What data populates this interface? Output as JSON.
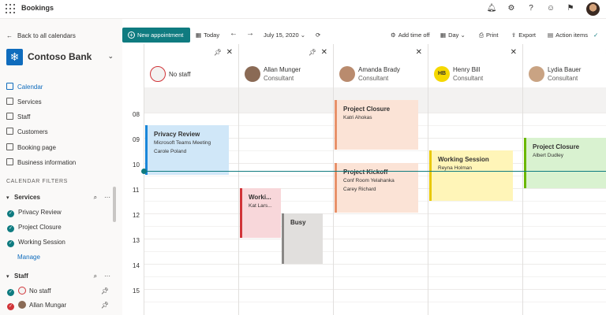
{
  "app": {
    "title": "Bookings"
  },
  "colors": {
    "accent": "#0f7b80",
    "brand": "#0f6cbd"
  },
  "sidebar": {
    "back_label": "Back to all calendars",
    "org_name": "Contoso Bank",
    "nav": [
      {
        "label": "Calendar",
        "icon": "calendar-icon",
        "active": true
      },
      {
        "label": "Services",
        "icon": "services-icon"
      },
      {
        "label": "Staff",
        "icon": "staff-icon"
      },
      {
        "label": "Customers",
        "icon": "customers-icon"
      },
      {
        "label": "Booking page",
        "icon": "booking-page-icon"
      },
      {
        "label": "Business information",
        "icon": "business-info-icon"
      }
    ],
    "filters_title": "CALENDAR FILTERS",
    "services_title": "Services",
    "services": [
      "Privacy Review",
      "Project Closure",
      "Working Session"
    ],
    "manage_label": "Manage",
    "staff_title": "Staff",
    "staff": [
      "No staff",
      "Allan Mungar"
    ]
  },
  "toolbar": {
    "new_label": "New appointment",
    "today_label": "Today",
    "date_label": "July 15, 2020",
    "add_time_off": "Add time off",
    "view_label": "Day",
    "print_label": "Print",
    "export_label": "Export",
    "action_items": "Action items"
  },
  "hours": [
    "08",
    "09",
    "10",
    "11",
    "12",
    "13",
    "14",
    "15"
  ],
  "columns": [
    {
      "name": "No staff",
      "role": "",
      "avatar_text": "",
      "avatar_color": "#f3f2f1",
      "pinned": true,
      "events": [
        {
          "title": "Privacy Review",
          "lines": [
            "Microsoft Teams Meeting",
            "Carole Poland"
          ],
          "color": "blue"
        }
      ]
    },
    {
      "name": "Allan Munger",
      "role": "Consultant",
      "avatar_text": "",
      "avatar_color": "#8a6a55",
      "pinned": true,
      "events": [
        {
          "title": "Worki...",
          "lines": [
            "Kat Lars..."
          ],
          "color": "red"
        },
        {
          "title": "Busy",
          "lines": [],
          "color": "gray"
        }
      ]
    },
    {
      "name": "Amanda Brady",
      "role": "Consultant",
      "avatar_text": "",
      "avatar_color": "#b98b6e",
      "pinned": false,
      "events": [
        {
          "title": "Project Closure",
          "lines": [
            "Katri Ahokas"
          ],
          "color": "orange"
        },
        {
          "title": "Project Kickoff",
          "lines": [
            "Conf Room Yelahanka",
            "Carey Richard"
          ],
          "color": "orange"
        }
      ]
    },
    {
      "name": "Henry Bill",
      "role": "Consultant",
      "avatar_text": "HB",
      "avatar_color": "#f5d800",
      "pinned": false,
      "events": [
        {
          "title": "Working Session",
          "lines": [
            "Reyna Holman"
          ],
          "color": "yellow"
        }
      ]
    },
    {
      "name": "Lydia Bauer",
      "role": "Consultant",
      "avatar_text": "",
      "avatar_color": "#c9a383",
      "pinned": false,
      "events": [
        {
          "title": "Project Closure",
          "lines": [
            "Albert Dudley"
          ],
          "color": "green"
        }
      ]
    }
  ]
}
